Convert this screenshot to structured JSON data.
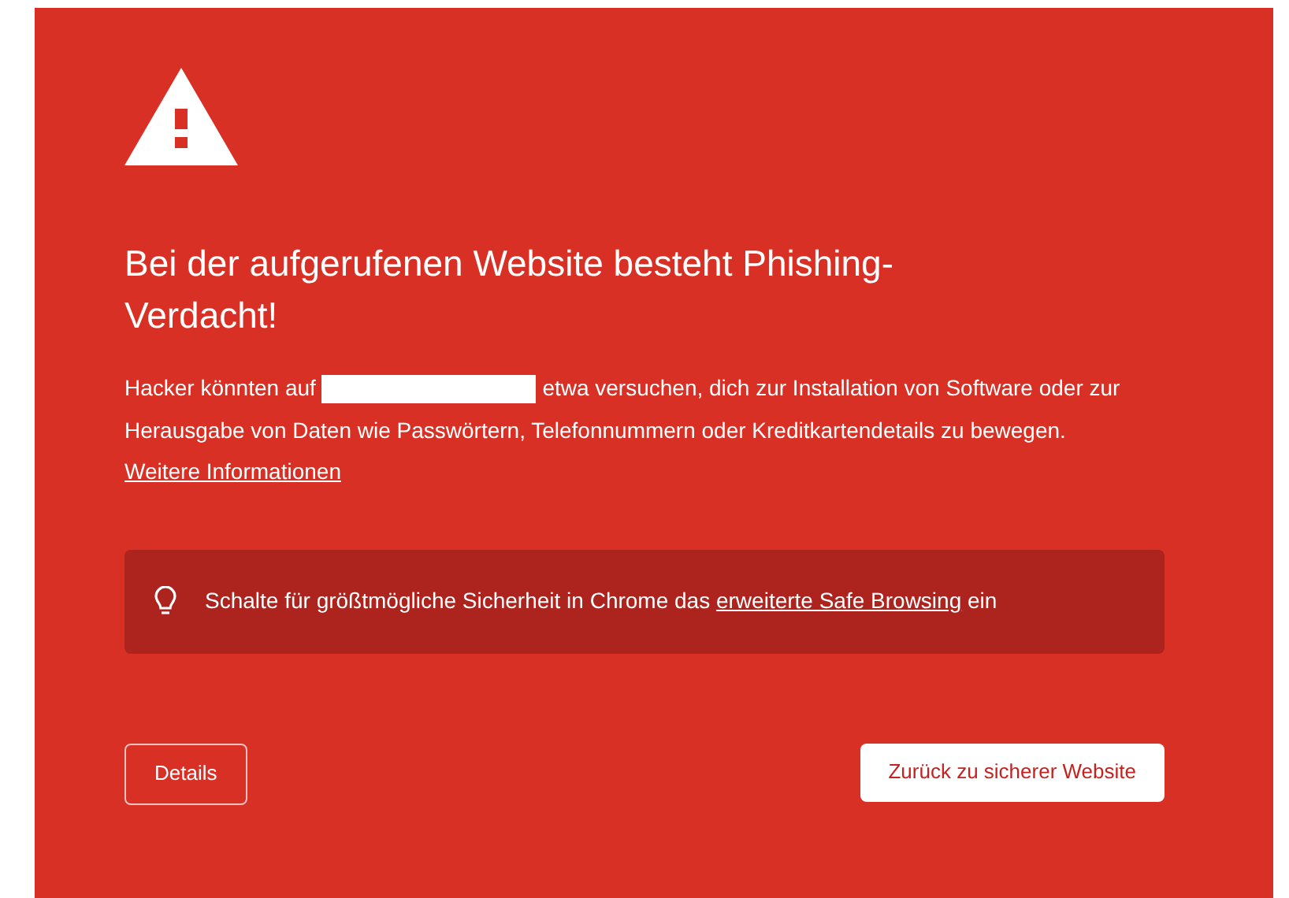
{
  "title": "Bei der aufgerufenen Website besteht Phishing-Verdacht!",
  "message": {
    "before": "Hacker könnten auf",
    "redacted": true,
    "after": "etwa versuchen, dich zur Installation von Software oder zur Herausgabe von Daten wie Passwörtern, Telefonnummern oder Kreditkartendetails zu bewegen.",
    "link": "Weitere Informationen"
  },
  "tip": {
    "before": "Schalte für größtmögliche Sicherheit in Chrome das",
    "link": "erweiterte Safe Browsing",
    "after": "ein"
  },
  "buttons": [
    {
      "label": "Details",
      "kind": "outline"
    },
    {
      "label": "Zurück zu sicherer Website",
      "kind": "primary"
    }
  ]
}
